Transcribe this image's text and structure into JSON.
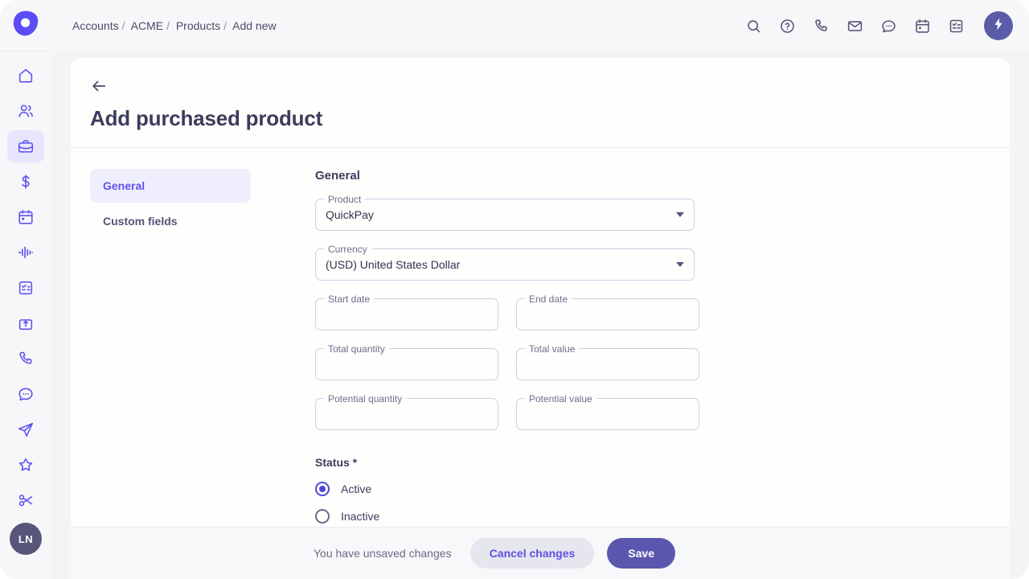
{
  "brand": {
    "logo_icon": "blob-logo-icon",
    "accent": "#5d52ef",
    "accent_muted": "#5b5ca8"
  },
  "breadcrumb": {
    "items": [
      "Accounts",
      "ACME",
      "Products",
      "Add new"
    ],
    "separator": "/"
  },
  "topbar": {
    "icons": [
      {
        "name": "search-icon",
        "label": "Search"
      },
      {
        "name": "help-icon",
        "label": "Help"
      },
      {
        "name": "phone-icon",
        "label": "Calls"
      },
      {
        "name": "mail-icon",
        "label": "Email"
      },
      {
        "name": "chat-icon",
        "label": "Chat"
      },
      {
        "name": "calendar-icon",
        "label": "Calendar"
      },
      {
        "name": "tasks-icon",
        "label": "Tasks"
      }
    ],
    "action_button": {
      "name": "bolt-button",
      "icon": "lightning-icon"
    }
  },
  "sidebar": {
    "items": [
      {
        "name": "sidebar-item-home",
        "icon": "home-icon",
        "active": false
      },
      {
        "name": "sidebar-item-contacts",
        "icon": "users-icon",
        "active": false
      },
      {
        "name": "sidebar-item-deals",
        "icon": "briefcase-icon",
        "active": true
      },
      {
        "name": "sidebar-item-sales",
        "icon": "dollar-icon",
        "active": false
      },
      {
        "name": "sidebar-item-calendar",
        "icon": "calendar-icon",
        "active": false
      },
      {
        "name": "sidebar-item-activity",
        "icon": "pulse-icon",
        "active": false
      },
      {
        "name": "sidebar-item-tasks",
        "icon": "checklist-icon",
        "active": false
      },
      {
        "name": "sidebar-item-imports",
        "icon": "upload-box-icon",
        "active": false
      },
      {
        "name": "sidebar-item-calls",
        "icon": "phone-icon",
        "active": false
      },
      {
        "name": "sidebar-item-messages",
        "icon": "chat-icon",
        "active": false
      },
      {
        "name": "sidebar-item-campaigns",
        "icon": "send-icon",
        "active": false
      },
      {
        "name": "sidebar-item-favorites",
        "icon": "star-icon",
        "active": false
      },
      {
        "name": "sidebar-item-tools",
        "icon": "scissors-icon",
        "active": false
      }
    ],
    "avatar_initials": "LN"
  },
  "page": {
    "back_icon": "arrow-left-icon",
    "title": "Add purchased product"
  },
  "tabs": [
    {
      "label": "General",
      "active": true
    },
    {
      "label": "Custom fields",
      "active": false
    }
  ],
  "form": {
    "section_title": "General",
    "fields": {
      "product": {
        "label": "Product",
        "value": "QuickPay",
        "type": "select"
      },
      "currency": {
        "label": "Currency",
        "value": "(USD) United States Dollar",
        "type": "select"
      },
      "start_date": {
        "label": "Start date",
        "value": "",
        "type": "text"
      },
      "end_date": {
        "label": "End date",
        "value": "",
        "type": "text"
      },
      "total_quantity": {
        "label": "Total quantity",
        "value": "",
        "type": "text"
      },
      "total_value": {
        "label": "Total value",
        "value": "",
        "type": "text"
      },
      "potential_quantity": {
        "label": "Potential quantity",
        "value": "",
        "type": "text"
      },
      "potential_value": {
        "label": "Potential value",
        "value": "",
        "type": "text"
      }
    },
    "status": {
      "label": "Status *",
      "options": [
        {
          "label": "Active",
          "selected": true
        },
        {
          "label": "Inactive",
          "selected": false
        }
      ]
    }
  },
  "footer": {
    "message": "You have unsaved changes",
    "cancel_label": "Cancel changes",
    "save_label": "Save"
  }
}
